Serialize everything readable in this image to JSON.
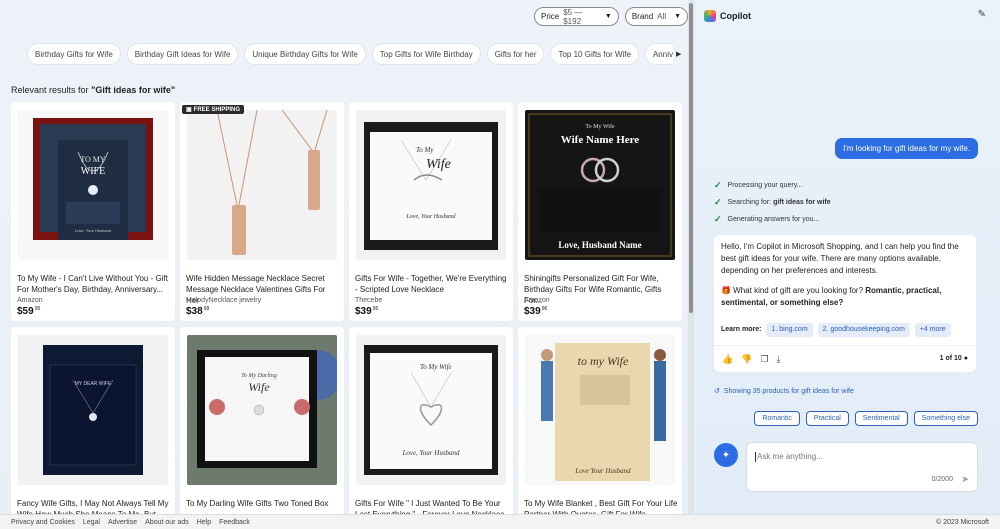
{
  "filters": {
    "price_label": "Price",
    "price_value": "$5 — $192",
    "brand_label": "Brand",
    "brand_value": "All"
  },
  "chips": [
    "Birthday Gifts for Wife",
    "Birthday Gift Ideas for Wife",
    "Unique Birthday Gifts for Wife",
    "Top Gifts for Wife Birthday",
    "Gifts for her",
    "Top 10 Gifts for Wife",
    "Anniversary Gift Id"
  ],
  "results": {
    "prefix": "Relevant results for",
    "query": "\"Gift ideas for wife\""
  },
  "products": [
    {
      "title": "To My Wife - I Can't Live Without You - Gift For Mother's Day, Birthday, Anniversary...",
      "store": "Amazon",
      "price": "$59",
      "cents": "95",
      "badge": "",
      "img_text": "TO MY WIFE"
    },
    {
      "title": "Wife Hidden Message Necklace Secret Message Necklace Valentines Gifts For Her",
      "store": "MelodyNecklace jewelry",
      "price": "$38",
      "cents": "99",
      "badge": "FREE SHIPPING",
      "img_text": ""
    },
    {
      "title": "Gifts For Wife - Together, We're Everything - Scripted Love Necklace",
      "store": "Thecebe",
      "price": "$39",
      "cents": "95",
      "badge": "",
      "img_text": "To My Wife"
    },
    {
      "title": "Shiningifts Personalized Gift For Wife, Birthday Gifts For Wife Romantic, Gifts For...",
      "store": "Amazon",
      "price": "$39",
      "cents": "96",
      "badge": "",
      "img_text": "Wife Name Here"
    },
    {
      "title": "Fancy Wife Gifts, I May Not Always Tell My Wife How Much She Means To Me, But She...",
      "store": "",
      "price": "",
      "cents": "",
      "badge": "",
      "img_text": "MY DEAR WIFE"
    },
    {
      "title": "To My Darling Wife Gifts Two Toned Box",
      "store": "",
      "price": "",
      "cents": "",
      "badge": "",
      "img_text": "Wife"
    },
    {
      "title": "Gifts For Wife \" I Just Wanted To Be Your Last Everything \" - Forever Love Necklace",
      "store": "",
      "price": "",
      "cents": "",
      "badge": "",
      "img_text": "To My Wife"
    },
    {
      "title": "To My Wife Blanket , Best Gift For Your Life Partner With Quotes, Gift For Wife...",
      "store": "",
      "price": "",
      "cents": "",
      "badge": "",
      "img_text": "to my Wife"
    }
  ],
  "copilot": {
    "title": "Copilot",
    "user_message": "I'm looking for gift ideas for my wife.",
    "steps": [
      {
        "text": "Processing your query...",
        "bold": ""
      },
      {
        "text": "Searching for: ",
        "bold": "gift ideas for wife"
      },
      {
        "text": "Generating answers for you...",
        "bold": ""
      }
    ],
    "answer_p1": "Hello, I'm Copilot in Microsoft Shopping, and I can help you find the best gift ideas for your wife. There are many options available, depending on her preferences and interests.",
    "answer_p2_lead": "🎁 What kind of gift are you looking for? ",
    "answer_p2_bold": "Romantic, practical, sentimental, or something else?",
    "learn_more": "Learn more:",
    "refs": [
      "1. bing.com",
      "2. goodhousekeeping.com",
      "+4 more"
    ],
    "pager": "1 of 10",
    "showing": "Showing 35 products for gift ideas for wife",
    "suggestions": [
      "Romantic",
      "Practical",
      "Sentimental",
      "Something else"
    ],
    "input_placeholder": "Ask me anything...",
    "char_count": "0/2000"
  },
  "footer": {
    "links": [
      "Privacy and Cookies",
      "Legal",
      "Advertise",
      "About our ads",
      "Help",
      "Feedback"
    ],
    "copyright": "© 2023 Microsoft"
  }
}
